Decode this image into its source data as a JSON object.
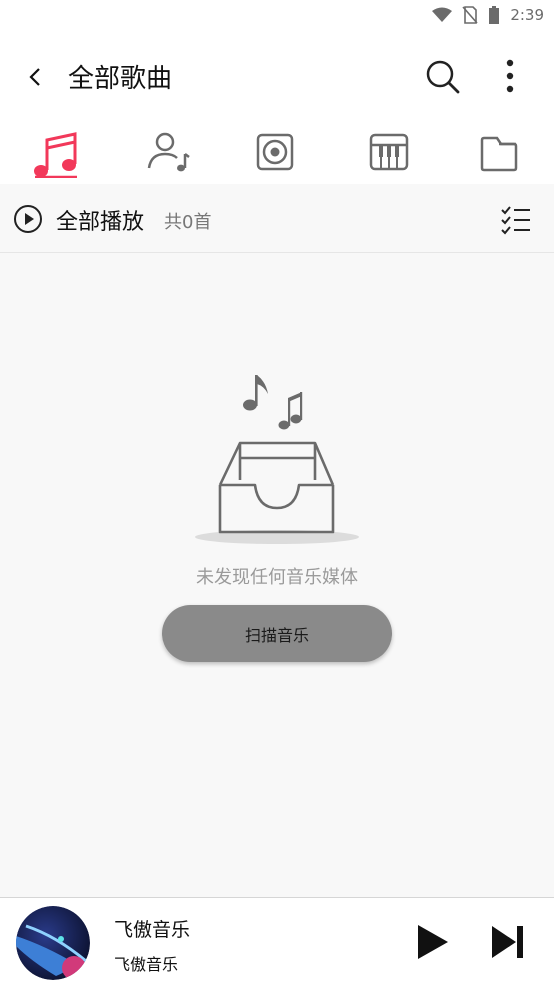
{
  "status_bar": {
    "time": "2:39",
    "icons": [
      "wifi-icon",
      "no-sim-icon",
      "battery-icon"
    ]
  },
  "header": {
    "title": "全部歌曲",
    "icons": [
      "back-arrow-icon",
      "search-icon",
      "more-vertical-icon"
    ]
  },
  "tabs": [
    {
      "name": "songs",
      "icon": "music-note-icon",
      "active": true
    },
    {
      "name": "artists",
      "icon": "artist-icon",
      "active": false
    },
    {
      "name": "albums",
      "icon": "album-icon",
      "active": false
    },
    {
      "name": "genres",
      "icon": "piano-icon",
      "active": false
    },
    {
      "name": "folders",
      "icon": "folder-icon",
      "active": false
    }
  ],
  "action_row": {
    "play_all_label": "全部播放",
    "count_label": "共0首"
  },
  "empty_state": {
    "message": "未发现任何音乐媒体",
    "scan_button_label": "扫描音乐"
  },
  "now_playing": {
    "title": "飞傲音乐",
    "artist": "飞傲音乐"
  },
  "colors": {
    "accent": "#f2385a",
    "icon_gray": "#6b6b6b",
    "button_gray": "#8a8a8a",
    "background": "#f8f8f8"
  }
}
